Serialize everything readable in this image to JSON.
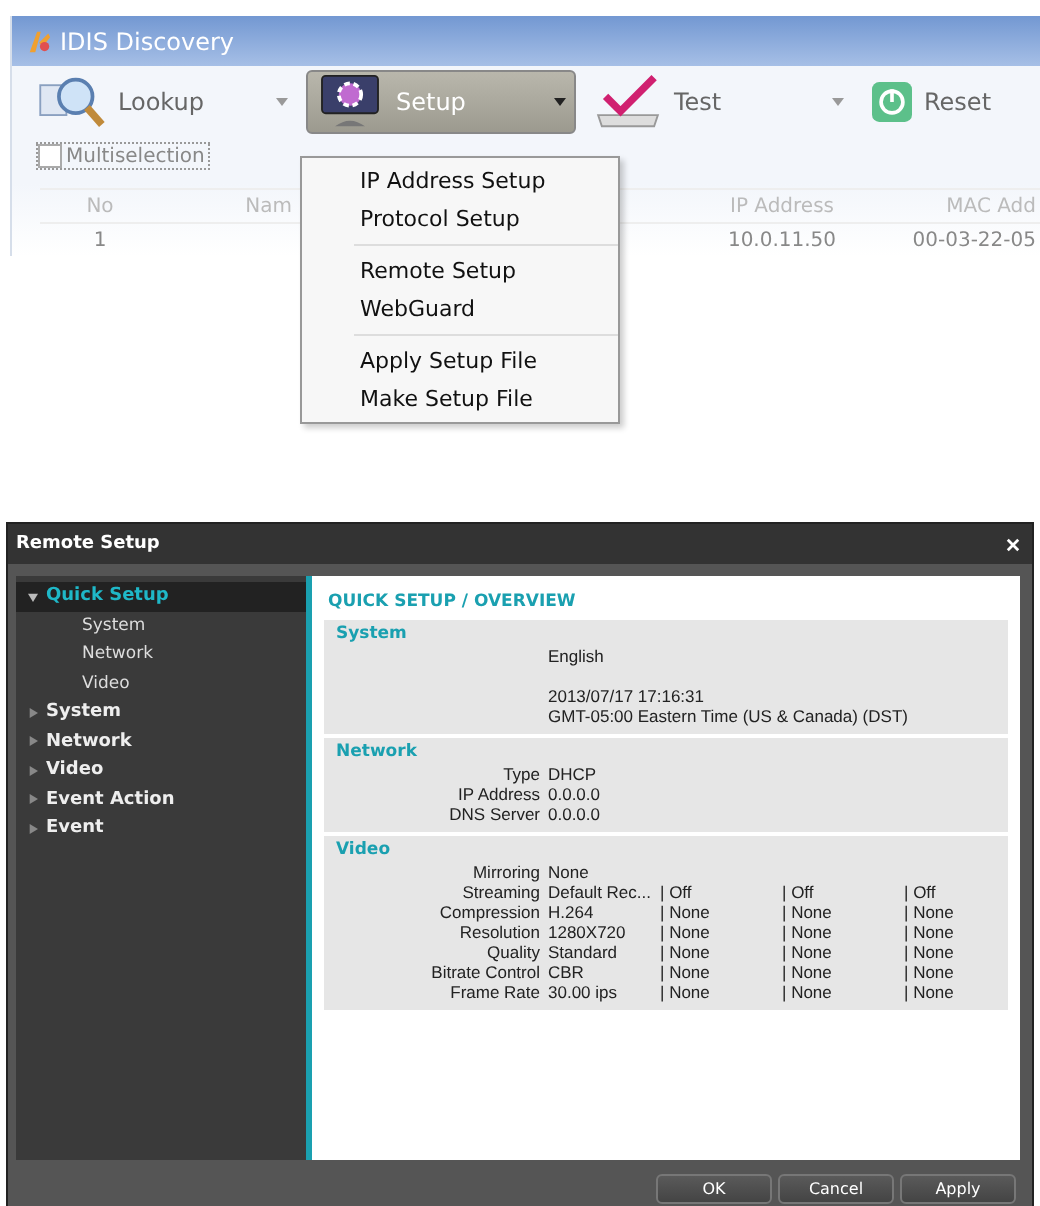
{
  "discovery": {
    "title": "IDIS Discovery",
    "toolbar": [
      {
        "label": "Lookup",
        "kind": "lookup",
        "selected": false
      },
      {
        "label": "Setup",
        "kind": "setup",
        "selected": true
      },
      {
        "label": "Test",
        "kind": "test",
        "selected": false
      },
      {
        "label": "Reset",
        "kind": "reset",
        "selected": false
      }
    ],
    "multiselection": {
      "label": "Multiselection",
      "checked": false
    },
    "table": {
      "columns": [
        "No",
        "Nam",
        "IP Address",
        "MAC Add"
      ],
      "rows": [
        [
          "1",
          "",
          "10.0.11.50",
          "00-03-22-05"
        ]
      ]
    },
    "menu": [
      [
        "IP Address Setup",
        "Protocol Setup"
      ],
      [
        "Remote Setup",
        "WebGuard"
      ],
      [
        "Apply Setup File",
        "Make Setup File"
      ]
    ]
  },
  "remote_setup": {
    "title": "Remote Setup",
    "tree": [
      {
        "label": "Quick Setup",
        "selected": true,
        "expanded": true,
        "children": [
          {
            "label": "System"
          },
          {
            "label": "Network"
          },
          {
            "label": "Video"
          }
        ]
      },
      {
        "label": "System",
        "selected": false,
        "expanded": false
      },
      {
        "label": "Network",
        "selected": false,
        "expanded": false
      },
      {
        "label": "Video",
        "selected": false,
        "expanded": false
      },
      {
        "label": "Event Action",
        "selected": false,
        "expanded": false
      },
      {
        "label": "Event",
        "selected": false,
        "expanded": false
      }
    ],
    "heading": "QUICK SETUP / OVERVIEW",
    "sections": [
      {
        "title": "System",
        "groups": [
          [
            {
              "values": [
                "English"
              ]
            }
          ],
          [
            {
              "values": [
                "2013/07/17 17:16:31"
              ]
            },
            {
              "values": [
                "GMT-05:00 Eastern Time (US & Canada) (DST)"
              ]
            }
          ]
        ]
      },
      {
        "title": "Network",
        "groups": [
          [
            {
              "label": "Type",
              "values": [
                "DHCP"
              ]
            },
            {
              "label": "IP Address",
              "values": [
                "0.0.0.0"
              ]
            },
            {
              "label": "DNS Server",
              "values": [
                "0.0.0.0"
              ]
            }
          ]
        ]
      },
      {
        "title": "Video",
        "groups": [
          [
            {
              "label": "Mirroring",
              "values": [
                "None"
              ]
            },
            {
              "label": "Streaming",
              "values": [
                "Default Rec...",
                "| Off",
                "| Off",
                "| Off"
              ]
            },
            {
              "label": "Compression",
              "values": [
                "H.264",
                "| None",
                "| None",
                "| None"
              ]
            },
            {
              "label": "Resolution",
              "values": [
                "1280X720",
                "| None",
                "| None",
                "| None"
              ]
            },
            {
              "label": "Quality",
              "values": [
                "Standard",
                "| None",
                "| None",
                "| None"
              ]
            },
            {
              "label": "Bitrate Control",
              "values": [
                "CBR",
                "| None",
                "| None",
                "| None"
              ]
            },
            {
              "label": "Frame Rate",
              "values": [
                "30.00 ips",
                "| None",
                "| None",
                "| None"
              ]
            }
          ]
        ]
      }
    ],
    "buttons": [
      "OK",
      "Cancel",
      "Apply"
    ]
  }
}
